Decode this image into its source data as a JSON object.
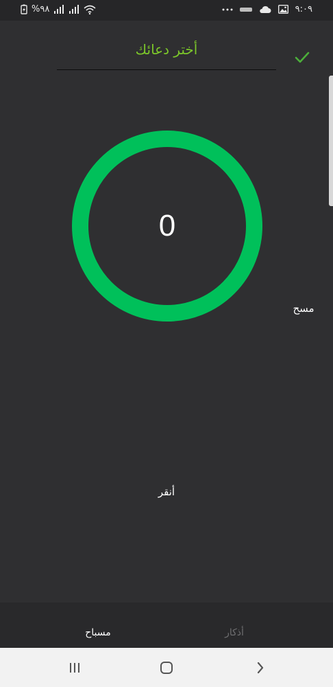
{
  "status_bar": {
    "time": "٩:٠٩",
    "battery": "%٩٨",
    "icons": [
      "charging-battery-icon",
      "signal-icon",
      "signal-icon",
      "wifi-icon",
      "more-dots-icon",
      "app-notification-icon",
      "cloud-icon",
      "image-icon"
    ]
  },
  "header": {
    "title": "أختر دعائك",
    "confirm_icon": "checkmark-icon"
  },
  "counter": {
    "value": "0",
    "ring_color": "#00c05a"
  },
  "actions": {
    "reset_label": "مسح",
    "tap_label": "أنقر"
  },
  "tabs": [
    {
      "label": "مسباح",
      "active": true
    },
    {
      "label": "أذكار",
      "active": false
    }
  ],
  "nav_bar": {
    "icons": [
      "recent-apps-icon",
      "home-icon",
      "back-icon"
    ]
  },
  "colors": {
    "accent": "#7cc72a",
    "ring": "#00c05a",
    "background": "#2f2f31"
  }
}
